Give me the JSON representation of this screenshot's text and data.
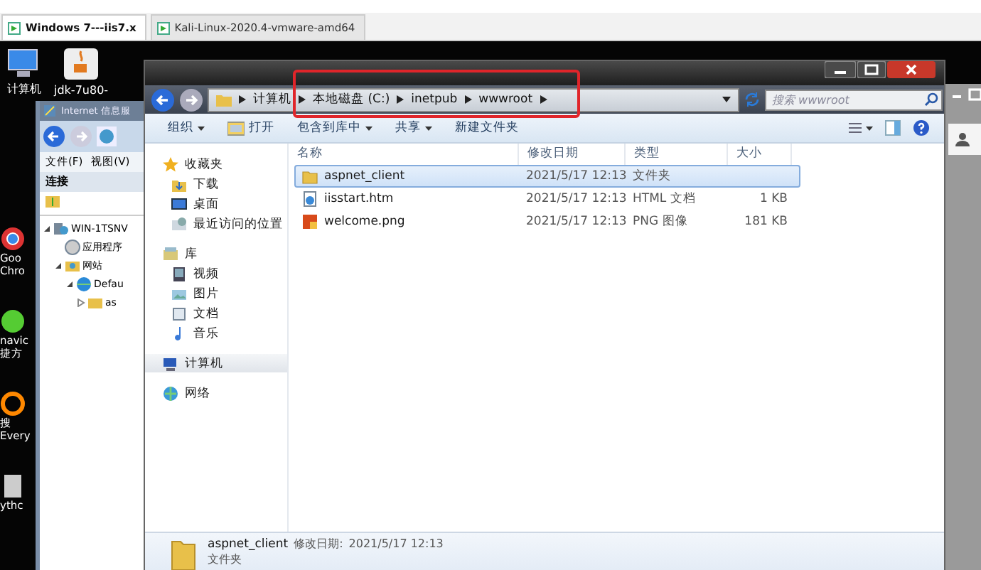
{
  "vm_tabs": [
    {
      "label": "Windows 7---iis7.x",
      "selected": true
    },
    {
      "label": "Kali-Linux-2020.4-vmware-amd64",
      "selected": false
    }
  ],
  "desktop_icons": [
    {
      "label": "计算机"
    },
    {
      "label": "jdk-7u80-"
    }
  ],
  "side_icons": [
    {
      "lines": [
        "Goo",
        "Chro"
      ]
    },
    {
      "lines": [
        "navic",
        "捷方"
      ]
    },
    {
      "lines": [
        "搜",
        "Every"
      ]
    },
    {
      "lines": [
        "ythc"
      ]
    }
  ],
  "iis_window": {
    "title": "Internet 信息服",
    "menu": [
      "文件(F)",
      "视图(V)"
    ],
    "pane_title": "连接",
    "tree": [
      {
        "label": "WIN-1TSNV",
        "expanded": true,
        "children": [
          {
            "label": "应用程序"
          },
          {
            "label": "网站",
            "expanded": true,
            "children": [
              {
                "label": "Defau",
                "expanded": true,
                "children": [
                  {
                    "label": "as",
                    "expanded": false
                  }
                ]
              }
            ]
          }
        ]
      }
    ]
  },
  "explorer": {
    "breadcrumbs": [
      "计算机",
      "本地磁盘 (C:)",
      "inetpub",
      "wwwroot"
    ],
    "search": {
      "placeholder": "搜索 wwwroot"
    },
    "toolbar": [
      {
        "label": "组织",
        "dropdown": true
      },
      {
        "label": "打开",
        "dropdown": false
      },
      {
        "label": "包含到库中",
        "dropdown": true
      },
      {
        "label": "共享",
        "dropdown": true
      },
      {
        "label": "新建文件夹",
        "dropdown": false
      }
    ],
    "nav": [
      {
        "label": "收藏夹",
        "selected": false,
        "children": [
          {
            "label": "下载",
            "selected": false
          },
          {
            "label": "桌面",
            "selected": false
          },
          {
            "label": "最近访问的位置",
            "selected": false
          }
        ]
      },
      {
        "label": "库",
        "selected": false,
        "children": [
          {
            "label": "视频",
            "selected": false
          },
          {
            "label": "图片",
            "selected": false
          },
          {
            "label": "文档",
            "selected": false
          },
          {
            "label": "音乐",
            "selected": false
          }
        ]
      },
      {
        "label": "计算机",
        "selected": true
      },
      {
        "label": "网络",
        "selected": false
      }
    ],
    "columns": [
      "名称",
      "修改日期",
      "类型",
      "大小"
    ],
    "rows": [
      {
        "kind": "folder",
        "name": "aspnet_client",
        "modified": "2021/5/17 12:13",
        "type": "文件夹",
        "size": "",
        "selected": true
      },
      {
        "kind": "html",
        "name": "iisstart.htm",
        "modified": "2021/5/17 12:13",
        "type": "HTML 文档",
        "size": "1 KB",
        "selected": false
      },
      {
        "kind": "image",
        "name": "welcome.png",
        "modified": "2021/5/17 12:13",
        "type": "PNG 图像",
        "size": "181 KB",
        "selected": false
      }
    ],
    "details": {
      "name": "aspnet_client",
      "modified_label": "修改日期:",
      "modified": "2021/5/17 12:13",
      "type": "文件夹"
    }
  }
}
